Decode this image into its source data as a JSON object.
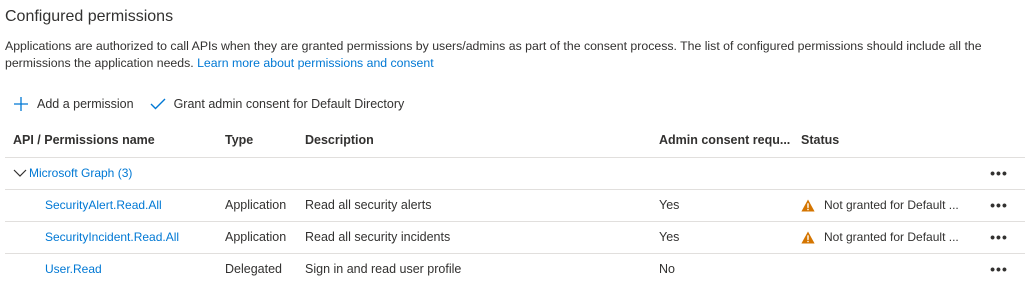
{
  "section": {
    "title": "Configured permissions",
    "description": "Applications are authorized to call APIs when they are granted permissions by users/admins as part of the consent process. The list of configured permissions should include all the permissions the application needs.",
    "learn_more": "Learn more about permissions and consent"
  },
  "toolbar": {
    "add_permission": "Add a permission",
    "grant_consent": "Grant admin consent for Default Directory"
  },
  "table": {
    "headers": {
      "api": "API / Permissions name",
      "type": "Type",
      "description": "Description",
      "admin_consent": "Admin consent requ...",
      "status": "Status"
    },
    "group": {
      "label": "Microsoft Graph (3)"
    },
    "rows": [
      {
        "name": "SecurityAlert.Read.All",
        "type": "Application",
        "description": "Read all security alerts",
        "admin_consent": "Yes",
        "status": "Not granted for Default ..."
      },
      {
        "name": "SecurityIncident.Read.All",
        "type": "Application",
        "description": "Read all security incidents",
        "admin_consent": "Yes",
        "status": "Not granted for Default ..."
      },
      {
        "name": "User.Read",
        "type": "Delegated",
        "description": "Sign in and read user profile",
        "admin_consent": "No",
        "status": ""
      }
    ],
    "more_glyph": "•••"
  },
  "colors": {
    "link": "#0078d4",
    "warning": "#d47500",
    "text": "#323130",
    "divider": "#e1dfdd"
  },
  "icons": {
    "add": "plus-icon",
    "grant": "checkmark-icon",
    "expand": "chevron-down-icon",
    "warning": "warning-icon",
    "more": "more-icon"
  }
}
